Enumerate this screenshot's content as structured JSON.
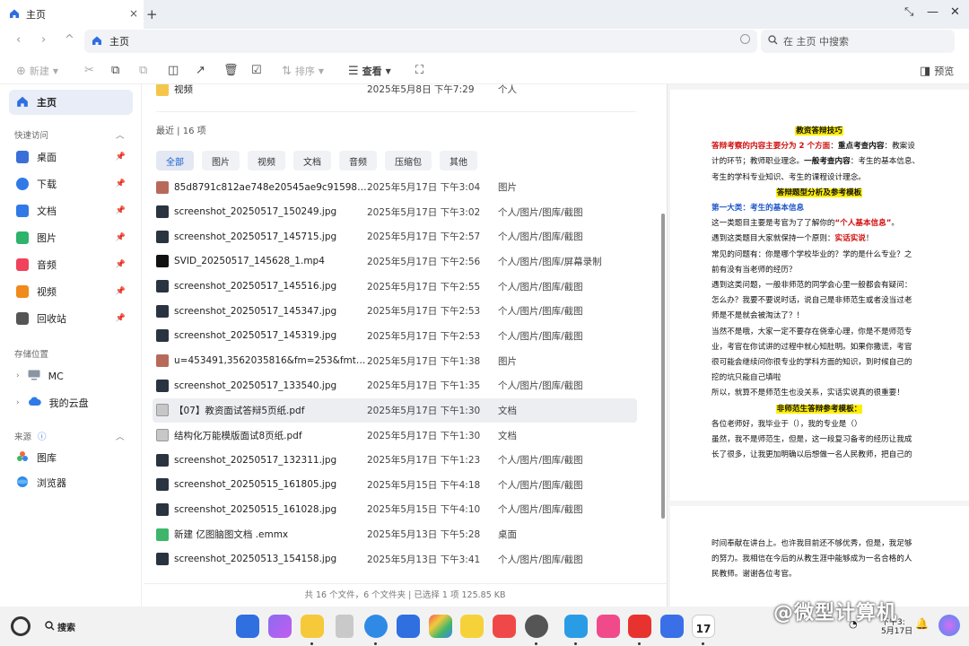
{
  "tab": {
    "title": "主页",
    "close": "×",
    "new": "+"
  },
  "window_controls": {
    "restore": "⤡",
    "minimize": "—",
    "close": "✕"
  },
  "nav": {
    "back": "‹",
    "forward": "›",
    "up": "^"
  },
  "address": {
    "path": "主页"
  },
  "search": {
    "placeholder": "在 主页 中搜索"
  },
  "toolbar": {
    "new_label": "新建",
    "sort_label": "排序",
    "view_label": "查看",
    "preview_label": "预览"
  },
  "sidebar": {
    "home": "主页",
    "quick_access_heading": "快速访问",
    "quick_access": [
      {
        "label": "桌面",
        "color": "#3b6fd8"
      },
      {
        "label": "下载",
        "color": "#2f7ae6"
      },
      {
        "label": "文档",
        "color": "#2f7ae6"
      },
      {
        "label": "图片",
        "color": "#2db36b"
      },
      {
        "label": "音频",
        "color": "#f0425a"
      },
      {
        "label": "视频",
        "color": "#f08a1c"
      },
      {
        "label": "回收站",
        "color": "#555555"
      }
    ],
    "storage_heading": "存储位置",
    "storage": [
      {
        "label": "MC"
      },
      {
        "label": "我的云盘"
      }
    ],
    "sources_heading": "来源",
    "sources": [
      {
        "label": "图库"
      },
      {
        "label": "浏览器"
      }
    ]
  },
  "top_item": {
    "name": "视频",
    "date": "2025年5月8日 下午7:29",
    "location": "个人"
  },
  "recent_heading": "最近 | 16 项",
  "filters": [
    "全部",
    "图片",
    "视频",
    "文档",
    "音频",
    "压缩包",
    "其他"
  ],
  "files": [
    {
      "name": "85d8791c812ae748e20545ae9c91598d...",
      "date": "2025年5月17日 下午3:04",
      "location": "图片",
      "icon": "image-file-icon"
    },
    {
      "name": "screenshot_20250517_150249.jpg",
      "date": "2025年5月17日 下午3:02",
      "location": "个人/图片/图库/截图",
      "icon": "screenshot-file-icon"
    },
    {
      "name": "screenshot_20250517_145715.jpg",
      "date": "2025年5月17日 下午2:57",
      "location": "个人/图片/图库/截图",
      "icon": "screenshot-file-icon"
    },
    {
      "name": "SVID_20250517_145628_1.mp4",
      "date": "2025年5月17日 下午2:56",
      "location": "个人/图片/图库/屏幕录制",
      "icon": "video-file-icon"
    },
    {
      "name": "screenshot_20250517_145516.jpg",
      "date": "2025年5月17日 下午2:55",
      "location": "个人/图片/图库/截图",
      "icon": "screenshot-file-icon"
    },
    {
      "name": "screenshot_20250517_145347.jpg",
      "date": "2025年5月17日 下午2:53",
      "location": "个人/图片/图库/截图",
      "icon": "screenshot-file-icon"
    },
    {
      "name": "screenshot_20250517_145319.jpg",
      "date": "2025年5月17日 下午2:53",
      "location": "个人/图片/图库/截图",
      "icon": "screenshot-file-icon"
    },
    {
      "name": "u=453491,3562035816&fm=253&fmt=a...",
      "date": "2025年5月17日 下午1:38",
      "location": "图片",
      "icon": "image-file-icon"
    },
    {
      "name": "screenshot_20250517_133540.jpg",
      "date": "2025年5月17日 下午1:35",
      "location": "个人/图片/图库/截图",
      "icon": "screenshot-file-icon"
    },
    {
      "name": "【07】教资面试答辩5页纸.pdf",
      "date": "2025年5月17日 下午1:30",
      "location": "文档",
      "icon": "pdf-file-icon"
    },
    {
      "name": "结构化万能模版面试8页纸.pdf",
      "date": "2025年5月17日 下午1:30",
      "location": "文档",
      "icon": "pdf-file-icon"
    },
    {
      "name": "screenshot_20250517_132311.jpg",
      "date": "2025年5月17日 下午1:23",
      "location": "个人/图片/图库/截图",
      "icon": "screenshot-file-icon"
    },
    {
      "name": "screenshot_20250515_161805.jpg",
      "date": "2025年5月15日 下午4:18",
      "location": "个人/图片/图库/截图",
      "icon": "screenshot-file-icon"
    },
    {
      "name": "screenshot_20250515_161028.jpg",
      "date": "2025年5月15日 下午4:10",
      "location": "个人/图片/图库/截图",
      "icon": "screenshot-file-icon"
    },
    {
      "name": "新建 亿图脑图文档 .emmx",
      "date": "2025年5月13日 下午5:28",
      "location": "桌面",
      "icon": "mindmap-file-icon"
    },
    {
      "name": "screenshot_20250513_154158.jpg",
      "date": "2025年5月13日 下午3:41",
      "location": "个人/图片/图库/截图",
      "icon": "screenshot-file-icon"
    }
  ],
  "status_bar": "共 16 个文件，6 个文件夹 | 已选择 1 项 125.85 KB",
  "preview_doc": {
    "title": "教资答辩技巧",
    "l1_red": "答辩考察的内容主要分为 2 个方面",
    "l1_b": "重点考查内容",
    "l1_rest": "：教案设",
    "l2": "计的环节；教师职业理念。",
    "l2_b": "一般考查内容",
    "l2_rest": "：考生的基本信息、",
    "l3": "考生的学科专业知识、考生的课程设计理念。",
    "h2": "答辩题型分析及参考模板",
    "cat1": "第一大类：考生的基本信息",
    "p1a": "这一类题目主要是考官为了了解你的",
    "p1b": "“个人基本信息”",
    "p1c": "。",
    "p2a": "遇到这类题目大家就保持一个原则：",
    "p2b": "实话实说",
    "p2c": "！",
    "p3": "常见的问题有：你是哪个学校毕业的？学的是什么专业？之",
    "p4": "前有没有当老师的经历？",
    "p5": "遇到这类问题，一般非师范的同学会心里一般都会有疑问：",
    "p6": "怎么办？我要不要说时话，说自己是非师范生或者没当过老",
    "p7": "师是不是就会被淘汰了？！",
    "p8": "当然不是哦，大家一定不要存在侥幸心理，你是不是师范专",
    "p9": "业，考官在你试讲的过程中就心知肚明。如果你撒谎，考官",
    "p10": "很可能会继续问你很专业的学科方面的知识，到时候自己的",
    "p11": "挖的坑只能自己填啦",
    "p12": "所以，就算不是师范生也没关系，实话实说真的很重要！",
    "h3": "非师范生答辩参考模板：",
    "p13": "各位老师好，我毕业于（），我的专业是（）",
    "p14": "虽然，我不是师范生，但是，这一段复习备考的经历让我成",
    "p15": "长了很多，让我更加明确以后想做一名人民教师，把自己的",
    "q1": "时间奉献在讲台上。也许我目前还不够优秀，但是，我足够",
    "q2": "的努力。我相信在今后的从教生涯中能够成为一名合格的人",
    "q3": "民教师。谢谢各位考官。"
  },
  "taskbar": {
    "search_label": "搜索",
    "calendar_day": "17",
    "clock_time": "下午3:",
    "clock_date": "5月17日"
  },
  "watermark": "@微型计算机"
}
